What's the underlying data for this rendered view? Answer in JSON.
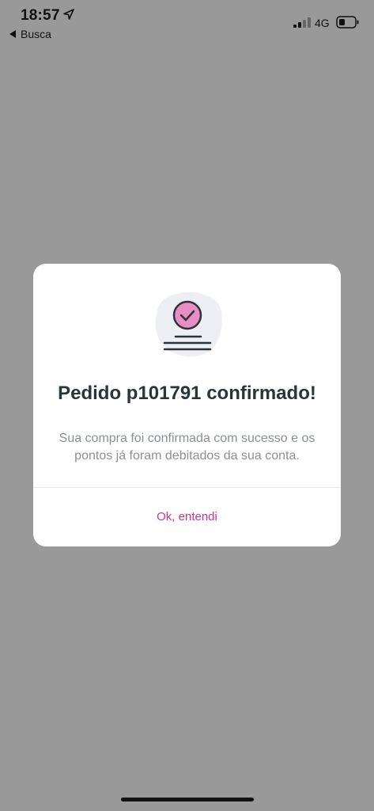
{
  "status_bar": {
    "time": "18:57",
    "back_label": "Busca",
    "network": "4G",
    "icons": [
      "location-arrow-icon",
      "signal-icon",
      "battery-icon"
    ]
  },
  "modal": {
    "illustration": "order-confirmed-illustration",
    "title": "Pedido p101791 confirmado!",
    "message": "Sua compra foi confirmada com sucesso e os pontos já foram debitados da sua conta.",
    "button_label": "Ok, entendi"
  },
  "colors": {
    "overlay": "#999999",
    "accent": "#c2378f",
    "title": "#2b3438",
    "text_secondary": "#8a9094"
  }
}
